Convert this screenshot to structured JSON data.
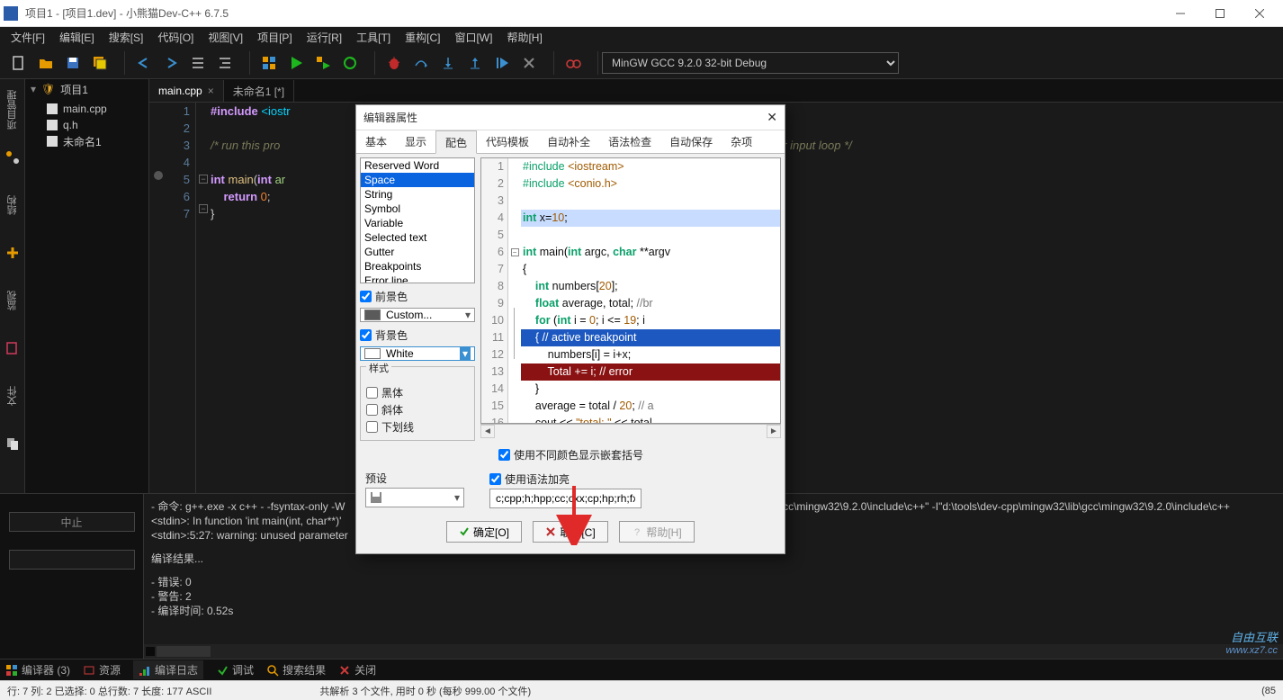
{
  "window": {
    "title": "项目1 - [项目1.dev] - 小熊猫Dev-C++ 6.7.5"
  },
  "menu": [
    "文件[F]",
    "编辑[E]",
    "搜索[S]",
    "代码[O]",
    "视图[V]",
    "项目[P]",
    "运行[R]",
    "工具[T]",
    "重构[C]",
    "窗口[W]",
    "帮助[H]"
  ],
  "compiler_combo": "MinGW GCC 9.2.0 32-bit Debug",
  "project": {
    "name": "项目1",
    "files": [
      "main.cpp",
      "q.h",
      "未命名1"
    ]
  },
  "editor_tabs": [
    {
      "label": "main.cpp",
      "active": true
    },
    {
      "label": "未命名1 [*]",
      "active": false
    }
  ],
  "code": {
    "lines": [
      "#include <iostr",
      "",
      "/* run this pro",
      "",
      "int main(int ar",
      "    return 0;",
      "}"
    ],
    "rendered_tail": "ystem(\"pause\") or input loop */"
  },
  "console": {
    "cmd": "- 命令: g++.exe -x c++ - -fsyntax-only -W",
    "cmd_tail": "gcc\\mingw32\\9.2.0\\include\\c++\" -I\"d:\\tools\\dev-cpp\\mingw32\\lib\\gcc\\mingw32\\9.2.0\\include\\c++",
    "l1": "<stdin>: In function 'int main(int, char**)'",
    "l2": "<stdin>:5:27: warning: unused parameter",
    "head": "编译结果...",
    "err": "- 错误: 0",
    "warn": "- 警告: 2",
    "time": "- 编译时间: 0.52s"
  },
  "bottom_buttons": {
    "stop": "中止"
  },
  "tabstrip": {
    "compiler": "编译器 (3)",
    "resource": "资源",
    "log": "编译日志",
    "debug": "调试",
    "search": "搜索结果",
    "close": "关闭"
  },
  "status": {
    "left": "行:  7  列:  2  已选择:  0  总行数:  7  长度:  177    ASCII",
    "center": "共解析 3 个文件, 用时 0 秒 (每秒 999.00 个文件)",
    "right": "(85"
  },
  "watermark": {
    "line1": "自由互联",
    "line2": "www.xz7.cc"
  },
  "dialog": {
    "title": "编辑器属性",
    "tabs": [
      "基本",
      "显示",
      "配色",
      "代码模板",
      "自动补全",
      "语法检查",
      "自动保存",
      "杂项"
    ],
    "active_tab": 2,
    "listbox": [
      "Reserved Word",
      "Space",
      "String",
      "Symbol",
      "Variable",
      "Selected text",
      "Gutter",
      "Breakpoints",
      "Error line"
    ],
    "list_selected": 1,
    "foreground_label": "前景色",
    "foreground_value": "Custom...",
    "background_label": "背景色",
    "background_value": "White",
    "style_legend": "样式",
    "style_opts": [
      "黑体",
      "斜体",
      "下划线"
    ],
    "nest_label": "使用不同颜色显示嵌套括号",
    "preset_label": "预设",
    "syntax_label": "使用语法加亮",
    "lang_input": "c;cpp;h;hpp;cc;cxx;cp;hp;rh;fx;inl;tcc;win;;",
    "buttons": {
      "ok": "确定[O]",
      "cancel": "取消[C]",
      "help": "帮助[H]"
    },
    "preview_lines": [
      "#include <iostream>",
      "#include <conio.h>",
      "",
      "int x=10;",
      "",
      "int main(int argc, char **argv",
      "{",
      "    int numbers[20];",
      "    float average, total; //br",
      "    for (int i = 0; i <= 19; i",
      "    { // active breakpoint",
      "        numbers[i] = i+x;",
      "        Total += i; // error ",
      "    }",
      "    average = total / 20; // a",
      "    cout << \"total: \" << total"
    ]
  },
  "chart_data": null
}
